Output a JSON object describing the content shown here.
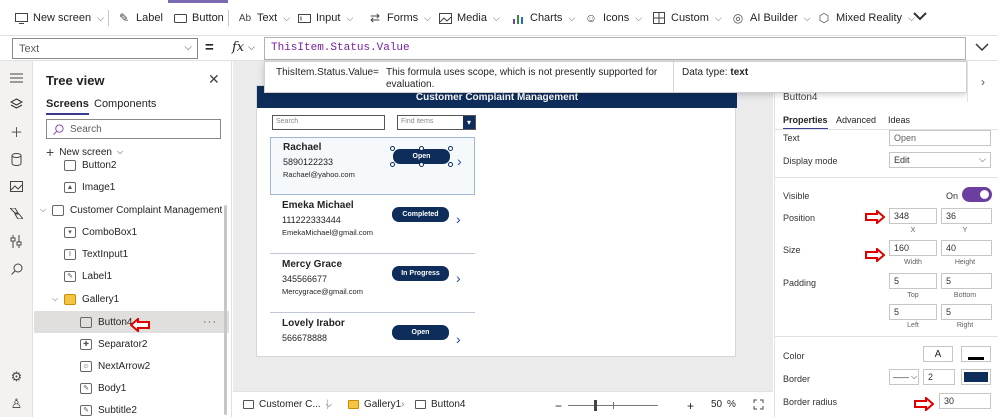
{
  "ribbon": {
    "new_screen": "New screen",
    "label": "Label",
    "button": "Button",
    "text": "Text",
    "input": "Input",
    "forms": "Forms",
    "media": "Media",
    "charts": "Charts",
    "icons": "Icons",
    "custom": "Custom",
    "ai_builder": "AI Builder",
    "mixed_reality": "Mixed Reality"
  },
  "formula_bar": {
    "property": "Text",
    "equals": "=",
    "fx": "fx",
    "formula": "ThisItem.Status.Value"
  },
  "hint": {
    "expression": "ThisItem.Status.Value",
    "equals": "=",
    "description": "This formula uses scope, which is not presently supported for evaluation.",
    "type_label": "Data type:",
    "type_value": "text"
  },
  "tree": {
    "title": "Tree view",
    "tab_screens": "Screens",
    "tab_components": "Components",
    "search_placeholder": "Search",
    "new_screen": "New screen",
    "nodes": [
      {
        "label": "Button2"
      },
      {
        "label": "Image1"
      },
      {
        "label": "Customer Complaint Management"
      },
      {
        "label": "ComboBox1"
      },
      {
        "label": "TextInput1"
      },
      {
        "label": "Label1"
      },
      {
        "label": "Gallery1"
      },
      {
        "label": "Button4"
      },
      {
        "label": "Separator2"
      },
      {
        "label": "NextArrow2"
      },
      {
        "label": "Body1"
      },
      {
        "label": "Subtitle2"
      }
    ]
  },
  "app": {
    "header": "Customer Complaint Management",
    "search_placeholder": "Search",
    "combo_placeholder": "Find items",
    "cards": [
      {
        "name": "Rachael",
        "phone": "5890122233",
        "email": "Rachael@yahoo.com",
        "status": "Open"
      },
      {
        "name": "Emeka Michael",
        "phone": "111222333444",
        "email": "EmekaMichael@gmail.com",
        "status": "Completed"
      },
      {
        "name": "Mercy Grace",
        "phone": "345566677",
        "email": "Mercygrace@gmail.com",
        "status": "In Progress"
      },
      {
        "name": "Lovely Irabor",
        "phone": "566678888",
        "email": "",
        "status": "Open"
      }
    ]
  },
  "bottombar": {
    "screen": "Customer C...",
    "gallery": "Gallery1",
    "button": "Button4",
    "zoom_minus": "−",
    "zoom_plus": "+",
    "zoom_value": "50",
    "zoom_unit": "%"
  },
  "props": {
    "control_name": "Button4",
    "tab_properties": "Properties",
    "tab_advanced": "Advanced",
    "tab_ideas": "Ideas",
    "text_label": "Text",
    "text_value": "Open",
    "display_mode_label": "Display mode",
    "display_mode_value": "Edit",
    "visible_label": "Visible",
    "visible_value": "On",
    "position_label": "Position",
    "x_value": "348",
    "y_value": "36",
    "x_label": "X",
    "y_label": "Y",
    "size_label": "Size",
    "width_value": "160",
    "height_value": "40",
    "width_label": "Width",
    "height_label": "Height",
    "padding_label": "Padding",
    "pad_top": "5",
    "pad_bottom": "5",
    "pad_left": "5",
    "pad_right": "5",
    "top_label": "Top",
    "bottom_label": "Bottom",
    "left_label": "Left",
    "right_label": "Right",
    "color_label": "Color",
    "color_a": "A",
    "border_label": "Border",
    "border_width": "2",
    "border_radius_label": "Border radius",
    "border_radius_value": "30"
  },
  "colors": {
    "brand_navy": "#0e2d5b",
    "toggle_purple": "#6b3fa0",
    "annotation_red": "#e00000"
  }
}
